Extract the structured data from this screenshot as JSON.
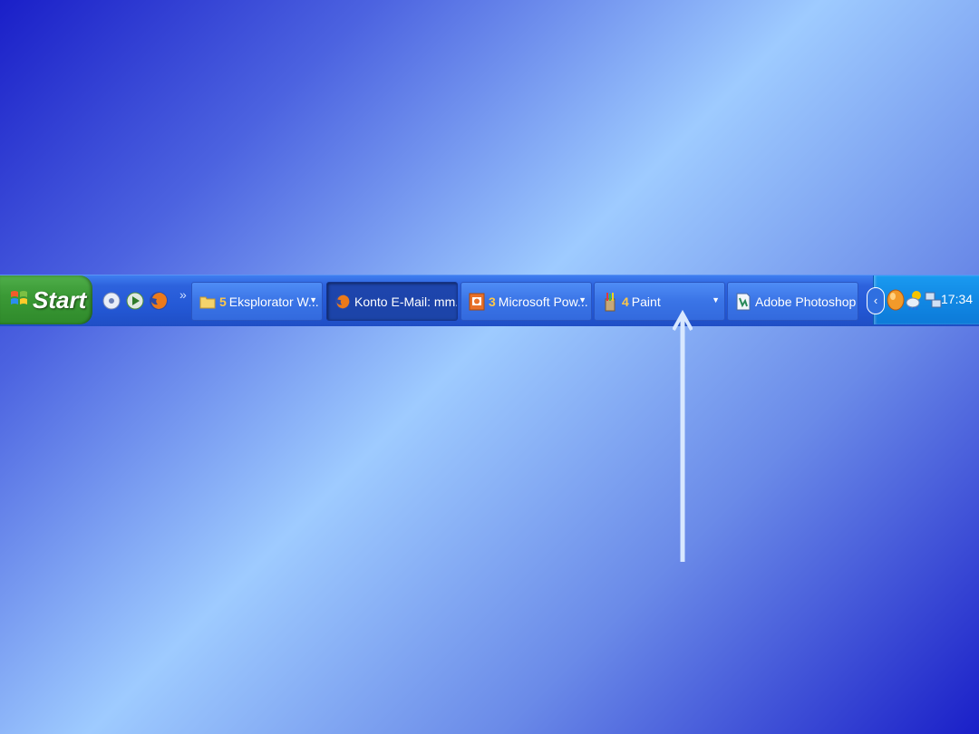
{
  "start": {
    "label": "Start"
  },
  "quicklaunch": {
    "icons": [
      "cd-player-icon",
      "media-player-icon",
      "firefox-icon"
    ],
    "more": "»"
  },
  "tasks": [
    {
      "count": "5",
      "label": "Eksplorator W...",
      "icon": "folder-icon",
      "dropdown": "▼",
      "active": false
    },
    {
      "count": "",
      "label": "Konto E-Mail: mm...",
      "icon": "firefox-icon",
      "dropdown": "",
      "active": true
    },
    {
      "count": "3",
      "label": "Microsoft Pow...",
      "icon": "powerpoint-icon",
      "dropdown": "▼",
      "active": false
    },
    {
      "count": "4",
      "label": "Paint",
      "icon": "paint-icon",
      "dropdown": "▼",
      "active": false
    },
    {
      "count": "",
      "label": "Adobe Photoshop",
      "icon": "photoshop-icon",
      "dropdown": "",
      "active": false
    }
  ],
  "tray": {
    "expand": "‹",
    "icons": [
      "orange-ball-icon",
      "weather-icon",
      "network-icon"
    ],
    "clock": "17:34"
  },
  "colors": {
    "taskbar": "#2459d6",
    "start": "#3b9a36",
    "tray": "#1188e4",
    "count": "#ffc84a"
  }
}
